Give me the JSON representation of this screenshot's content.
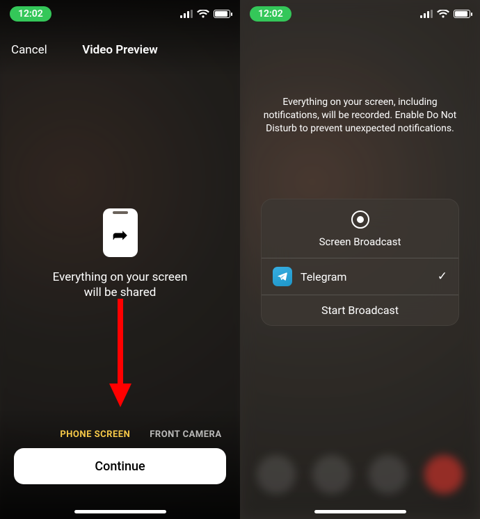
{
  "status": {
    "time": "12:02"
  },
  "left": {
    "cancel": "Cancel",
    "title": "Video Preview",
    "share_line1": "Everything on your screen",
    "share_line2": "will be shared",
    "seg_active": "PHONE SCREEN",
    "seg_other": "FRONT CAMERA",
    "continue": "Continue"
  },
  "right": {
    "toast": "Everything on your screen, including notifications, will be recorded. Enable Do Not Disturb to prevent unexpected notifications.",
    "panel_title": "Screen Broadcast",
    "app_name": "Telegram",
    "start": "Start Broadcast"
  }
}
